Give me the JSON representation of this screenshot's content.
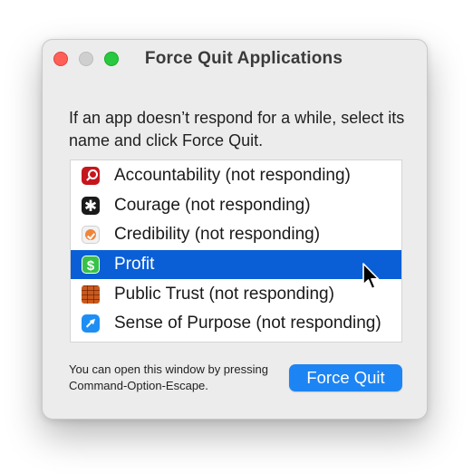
{
  "window": {
    "title": "Force Quit Applications",
    "instructions": "If an app doesn’t respond for a while, select its name and click Force Quit."
  },
  "app_list": {
    "items": [
      {
        "name": "Accountability (not responding)",
        "icon": "magnifier-icon",
        "selected": false
      },
      {
        "name": "Courage (not responding)",
        "icon": "asterisk-icon",
        "glyph": "✱",
        "selected": false
      },
      {
        "name": "Credibility (not responding)",
        "icon": "checkmark-badge-icon",
        "selected": false
      },
      {
        "name": "Profit",
        "icon": "dollar-sign-icon",
        "glyph": "$",
        "selected": true
      },
      {
        "name": "Public Trust (not responding)",
        "icon": "brick-wall-icon",
        "selected": false
      },
      {
        "name": "Sense of Purpose (not responding)",
        "icon": "arrow-icon",
        "selected": false
      }
    ]
  },
  "footer": {
    "note": "You can open this window by pressing Command-Option-Escape.",
    "button_label": "Force Quit"
  },
  "colors": {
    "selection": "#0a5fd6",
    "button": "#1d84f4",
    "close": "#ff5f57",
    "zoom": "#28c840"
  }
}
